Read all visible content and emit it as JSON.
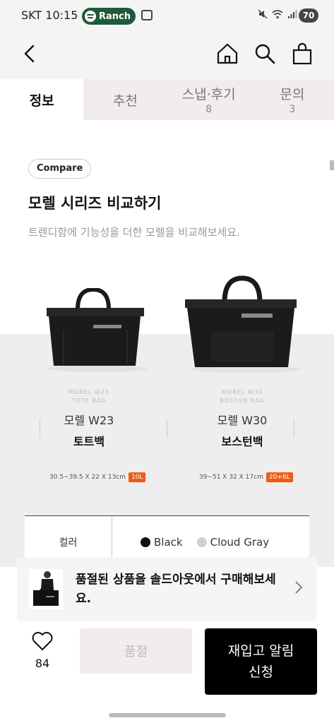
{
  "status_bar": {
    "carrier": "SKT",
    "time": "10:15",
    "media_app": "Ranch",
    "icons": [
      "mute-icon",
      "wifi-icon",
      "signal-icon"
    ],
    "battery": "70"
  },
  "header": {
    "icons": [
      "back-icon",
      "home-icon",
      "search-icon",
      "shopping-bag-icon"
    ]
  },
  "tabs": [
    {
      "label": "정보",
      "count": "",
      "active": true
    },
    {
      "label": "추천",
      "count": "",
      "active": false
    },
    {
      "label": "스냅·후기",
      "count": "8",
      "active": false
    },
    {
      "label": "문의",
      "count": "3",
      "active": false
    }
  ],
  "compare": {
    "chip": "Compare",
    "title": "모렐 시리즈 비교하기",
    "subtitle": "트렌디함에 기능성을 더한 모렐을 비교해보세요."
  },
  "products": [
    {
      "code_line1": "MOREL W23",
      "code_line2": "TOTE BAG",
      "name": "모렐 W23",
      "type": "토트백",
      "dimensions": "30.5~39.5 X 22 X 13cm",
      "volume": "10L"
    },
    {
      "code_line1": "MOREL W30",
      "code_line2": "BOSTON BAG",
      "name": "모렐 W30",
      "type": "보스턴백",
      "dimensions": "39~51 X 32 X 17cm",
      "volume": "20+6L"
    }
  ],
  "color_row": {
    "label": "컬러",
    "options": [
      {
        "name": "Black",
        "color": "#111111"
      },
      {
        "name": "Cloud Gray",
        "color": "#d0d0d0"
      }
    ]
  },
  "soldout_banner": {
    "text": "품절된 상품을 솔드아웃에서 구매해보세요."
  },
  "bottom_bar": {
    "like_count": "84",
    "soldout_label": "품절",
    "notify_label": "재입고 알림 신청"
  },
  "colors": {
    "accent_orange": "#f05a14",
    "tab_bg": "#f2ecee",
    "notify_bg": "#000000"
  }
}
